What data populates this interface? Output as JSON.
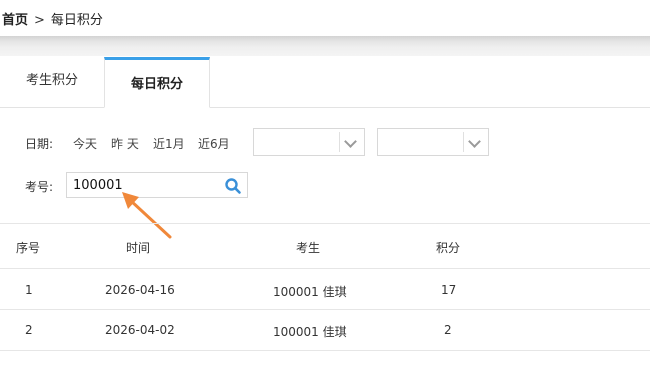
{
  "breadcrumb": {
    "home": "首页",
    "separator": ">",
    "current": "每日积分"
  },
  "tabs": [
    {
      "label": "考生积分",
      "active": false
    },
    {
      "label": "每日积分",
      "active": true
    }
  ],
  "filters": {
    "date_label": "日期:",
    "quick_ranges": [
      "今天",
      "昨 天",
      "近1月",
      "近6月"
    ],
    "start_select_value": "",
    "end_select_value": "",
    "id_label": "考号:",
    "id_value": "100001"
  },
  "table": {
    "headers": [
      "序号",
      "时间",
      "考生",
      "积分"
    ],
    "rows": [
      [
        "1",
        "2026-04-16",
        "100001 佳琪",
        "17"
      ],
      [
        "2",
        "2026-04-02",
        "100001 佳琪",
        "2"
      ]
    ]
  },
  "colors": {
    "accent": "#3aa0e8",
    "arrow": "#f0883a",
    "search_icon": "#3a90d8"
  }
}
